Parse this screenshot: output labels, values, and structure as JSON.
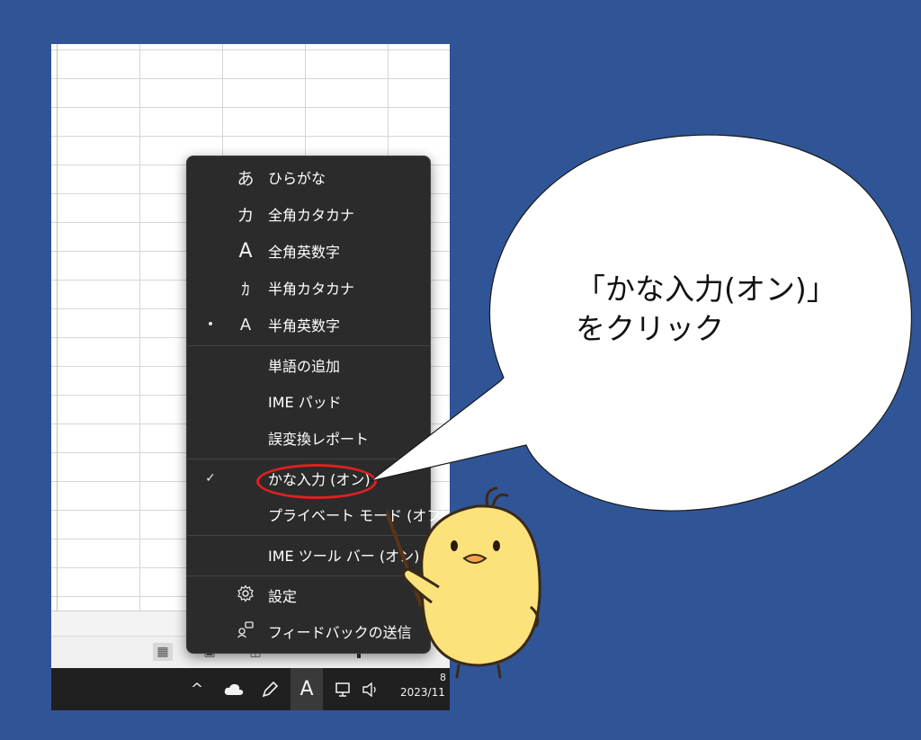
{
  "menu": {
    "items": [
      {
        "mark": "",
        "glyph": "あ",
        "label": "ひらがな"
      },
      {
        "mark": "",
        "glyph": "カ",
        "label": "全角カタカナ"
      },
      {
        "mark": "",
        "glyph": "A",
        "label": "全角英数字"
      },
      {
        "mark": "",
        "glyph": "ｶ",
        "label": "半角カタカナ"
      },
      {
        "mark": "•",
        "glyph": "A",
        "label": "半角英数字"
      },
      {
        "label": "単語の追加"
      },
      {
        "label": "IME パッド"
      },
      {
        "label": "誤変換レポート"
      },
      {
        "mark": "✓",
        "label": "かな入力 (オン)"
      },
      {
        "label": "プライベート モード (オフ)"
      },
      {
        "label": "IME ツール バー (オン)"
      },
      {
        "label": "設定"
      },
      {
        "label": "フィードバックの送信"
      }
    ],
    "settings_icon": "gear-icon",
    "feedback_icon": "feedback-icon"
  },
  "callout": {
    "line1": "「かな入力(オン)」",
    "line2": "をクリック"
  },
  "taskbar": {
    "chevron": "^",
    "ime_indicator": "A",
    "date": "2023/11",
    "time_fragment": "8"
  },
  "colors": {
    "background": "#2f5597",
    "menu_bg": "#2b2b2b",
    "highlight": "#e02020",
    "chick": "#fbe27a"
  }
}
